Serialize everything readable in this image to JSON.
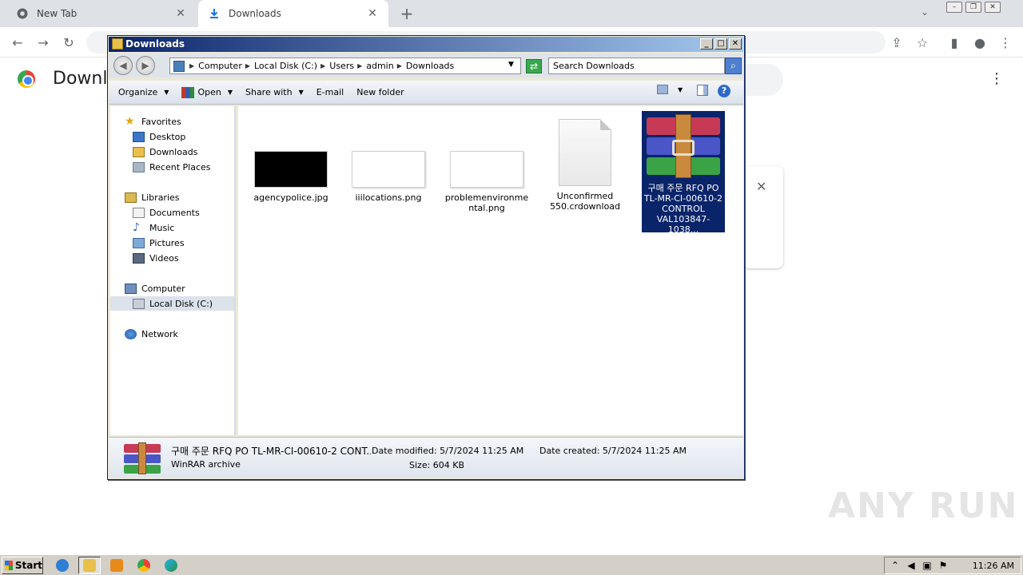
{
  "browser": {
    "tabs": [
      {
        "title": "New Tab"
      },
      {
        "title": "Downloads"
      }
    ],
    "page_title": "Downlo"
  },
  "explorer": {
    "title": "Downloads",
    "breadcrumb": [
      "Computer",
      "Local Disk (C:)",
      "Users",
      "admin",
      "Downloads"
    ],
    "search_placeholder": "Search Downloads",
    "commands": {
      "organize": "Organize",
      "open": "Open",
      "share_with": "Share with",
      "email": "E-mail",
      "new_folder": "New folder"
    },
    "nav": {
      "favorites": "Favorites",
      "desktop": "Desktop",
      "downloads": "Downloads",
      "recent": "Recent Places",
      "libraries": "Libraries",
      "documents": "Documents",
      "music": "Music",
      "pictures": "Pictures",
      "videos": "Videos",
      "computer": "Computer",
      "local_disk": "Local Disk (C:)",
      "network": "Network"
    },
    "files": [
      {
        "name": "agencypolice.jpg"
      },
      {
        "name": "iiilocations.png"
      },
      {
        "name": "problemenvironmental.png"
      },
      {
        "name": "Unconfirmed 550.crdownload"
      },
      {
        "name": "구매 주문 RFQ PO TL-MR-CI-00610-2 CONTROL VAL103847-1038..."
      }
    ],
    "details": {
      "name": "구매 주문 RFQ PO TL-MR-CI-00610-2 CONT...",
      "type": "WinRAR archive",
      "date_modified_label": "Date modified:",
      "date_modified": "5/7/2024 11:25 AM",
      "date_created_label": "Date created:",
      "date_created": "5/7/2024 11:25 AM",
      "size_label": "Size:",
      "size": "604 KB"
    }
  },
  "taskbar": {
    "start": "Start",
    "clock": "11:26 AM"
  },
  "watermark": "ANY RUN"
}
